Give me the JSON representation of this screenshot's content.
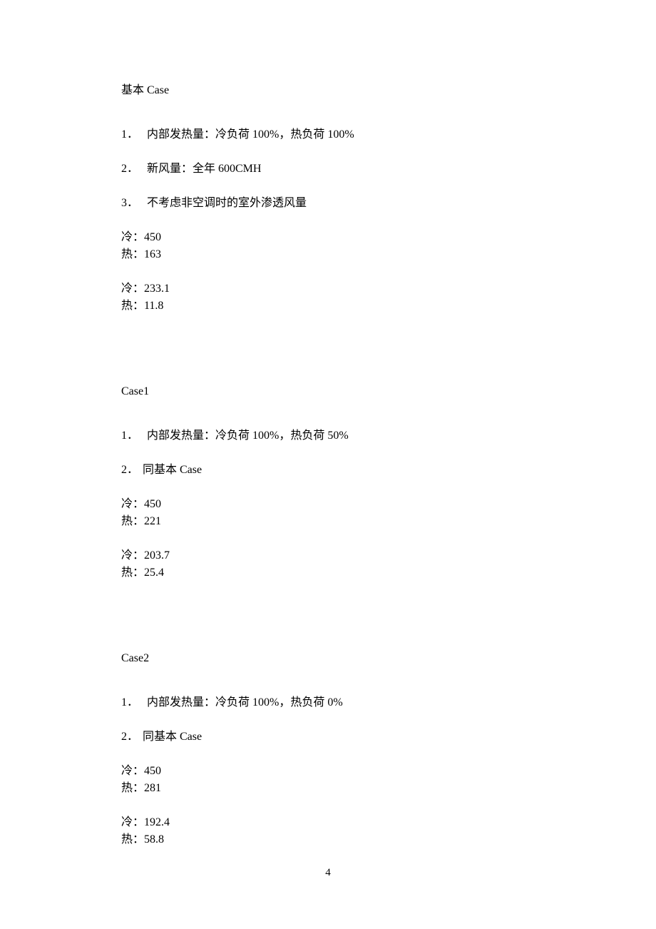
{
  "sections": [
    {
      "title": "基本 Case",
      "items": [
        {
          "num": "1．",
          "text": "内部发热量：冷负荷 100%，热负荷 100%"
        },
        {
          "num": "2．",
          "text": "新风量：全年 600CMH"
        },
        {
          "num": "3．",
          "text": "不考虑非空调时的室外渗透风量"
        }
      ],
      "blocks": [
        {
          "cold": "冷：450",
          "hot": "热：163"
        },
        {
          "cold": "冷：233.1",
          "hot": "热：11.8"
        }
      ]
    },
    {
      "title": "Case1",
      "items": [
        {
          "num": "1．",
          "text": "内部发热量：冷负荷 100%，热负荷 50%"
        },
        {
          "num": "2．",
          "text": "同基本 Case"
        }
      ],
      "blocks": [
        {
          "cold": "冷：450",
          "hot": "热：221"
        },
        {
          "cold": "冷：203.7",
          "hot": "热：25.4"
        }
      ]
    },
    {
      "title": "Case2",
      "items": [
        {
          "num": "1．",
          "text": "内部发热量：冷负荷 100%，热负荷 0%"
        },
        {
          "num": "2．",
          "text": "同基本 Case"
        }
      ],
      "blocks": [
        {
          "cold": "冷：450",
          "hot": "热：281"
        },
        {
          "cold": "冷：192.4",
          "hot": "热：58.8"
        }
      ]
    }
  ],
  "page_number": "4"
}
